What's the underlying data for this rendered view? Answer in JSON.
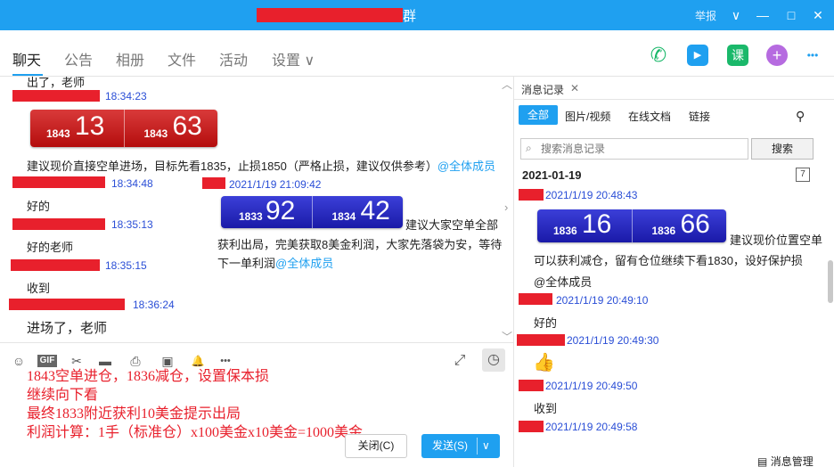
{
  "window": {
    "title_suffix": "群",
    "report": "举报",
    "btn_collapse": "∨",
    "btn_min": "—",
    "btn_max": "□",
    "btn_close": "✕"
  },
  "tabs": [
    {
      "label": "聊天"
    },
    {
      "label": "公告"
    },
    {
      "label": "相册"
    },
    {
      "label": "文件"
    },
    {
      "label": "活动"
    },
    {
      "label": "设置 ∨"
    }
  ],
  "toolbar_icons": {
    "call": "✆",
    "video": "▶",
    "course": "课",
    "add": "+",
    "more": "•••"
  },
  "chat": {
    "top_fragment": "出了，老师",
    "t1": "18:34:23",
    "box1": {
      "a_small": "1843",
      "a_big": "13",
      "b_small": "1843",
      "b_big": "63"
    },
    "msg1_text": "建议现价直接空单进场，目标先看1835，止损1850（严格止损，建议仅供参考）",
    "mention": "@全体成员",
    "t2": "18:34:48",
    "t2_inline": "2021/1/19 21:09:42",
    "box2": {
      "a_small": "1833",
      "a_big": "92",
      "b_small": "1834",
      "b_big": "42"
    },
    "msg2_line1": "建议大家空单全部",
    "msg2_line2": "获利出局，完美获取8美金利润，大家先落袋为安，等待",
    "msg2_line3": "下一单利润",
    "msg_hao": "好的",
    "t3": "18:35:13",
    "msg_hao_laoshi": "好的老师",
    "t4": "18:35:15",
    "msg_shoudao": "收到",
    "t5": "18:36:24",
    "msg_jinchang": "进场了，老师",
    "scroll_up": "︿",
    "scroll_down": "﹀",
    "expand": "›"
  },
  "input_icons": {
    "emoji": "☺",
    "gif": "GIF",
    "scissors": "✂",
    "folder": "▬",
    "file": "⎙",
    "image": "▣",
    "bell": "🔔",
    "more": "•••",
    "fullscreen": "⤢",
    "clock": "◷"
  },
  "draft_lines": [
    "1843空单进仓，1836减仓，设置保本损",
    "继续向下看",
    "最终1833附近获利10美金提示出局",
    "利润计算：1手（标准仓）x100美金x10美金=1000美金"
  ],
  "buttons": {
    "close": "关闭(C)",
    "send": "发送(S)",
    "send_dd": "∨"
  },
  "history": {
    "tab": "消息记录",
    "tab_close": "✕",
    "filters": [
      "全部",
      "图片/视频",
      "在线文档",
      "链接"
    ],
    "filter_icon": "⚲",
    "search_placeholder": "搜索消息记录",
    "search_btn": "搜索",
    "date": "2021-01-19",
    "cal_num": "7",
    "h_t1": "2021/1/19 20:48:43",
    "h_box": {
      "a_small": "1836",
      "a_big": "16",
      "b_small": "1836",
      "b_big": "66"
    },
    "h_msg1_inline": "建议现价位置空单",
    "h_msg1_line2": "可以获利减仓，留有仓位继续下看1830，设好保护损",
    "h_mention": "@全体成员",
    "h_t2": "2021/1/19 20:49:10",
    "h_msg2": "好的",
    "h_t3": "2021/1/19 20:49:30",
    "thumb": "👍",
    "h_t4": "2021/1/19 20:49:50",
    "h_msg4": "收到",
    "h_t5": "2021/1/19 20:49:58",
    "manage": "消息管理",
    "manage_icon": "▤"
  }
}
